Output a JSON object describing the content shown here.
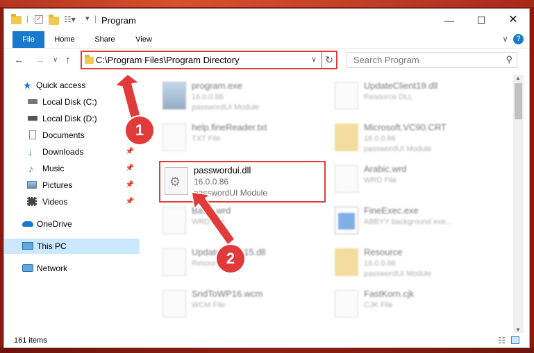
{
  "window": {
    "title": "Program"
  },
  "ribbon": {
    "tabs": [
      "File",
      "Home",
      "Share",
      "View"
    ],
    "help_label": "?",
    "expand_label": "∨"
  },
  "address": {
    "path": "C:\\Program Files\\Program Directory",
    "dropdown_label": "∨",
    "refresh_label": "↻"
  },
  "search": {
    "placeholder": "Search Program",
    "icon": "search-icon"
  },
  "nav": {
    "back": "←",
    "forward": "→",
    "recent": "∨",
    "up": "↑"
  },
  "sidebar": {
    "items": [
      {
        "label": "Quick access"
      },
      {
        "label": "Local Disk (C:)"
      },
      {
        "label": "Local Disk (D:)"
      },
      {
        "label": "Documents"
      },
      {
        "label": "Downloads"
      },
      {
        "label": "Music"
      },
      {
        "label": "Pictures"
      },
      {
        "label": "Videos"
      },
      {
        "label": "OneDrive"
      },
      {
        "label": "This PC"
      },
      {
        "label": "Network"
      }
    ]
  },
  "files": [
    {
      "name": "program.exe",
      "line2": "16.0.0.86",
      "line3": "passwordUI Module"
    },
    {
      "name": "UpdateClient19.dll",
      "line2": "Resource DLL",
      "line3": ""
    },
    {
      "name": "help.fineReader.txt",
      "line2": "TXT File",
      "line3": ""
    },
    {
      "name": "Microsoft.VC90.CRT",
      "line2": "16.0.0.86",
      "line3": "passwordUI Module"
    },
    {
      "name": "passwordui.dll",
      "line2": "16.0.0.86",
      "line3": "passwordUI Module"
    },
    {
      "name": "Arabic.wrd",
      "line2": "WRD File",
      "line3": ""
    },
    {
      "name": "Basic.wrd",
      "line2": "WRD File",
      "line3": ""
    },
    {
      "name": "FineExec.exe",
      "line2": "ABBYY background exe...",
      "line3": ""
    },
    {
      "name": "UpdateClient15.dll",
      "line2": "Resource DLL",
      "line3": ""
    },
    {
      "name": "Resource",
      "line2": "16.0.0.86",
      "line3": "passwordUI Module"
    },
    {
      "name": "SndToWP16.wcm",
      "line2": "WCM File",
      "line3": ""
    },
    {
      "name": "FastKorn.cjk",
      "line2": "CJK File",
      "line3": ""
    }
  ],
  "status": {
    "count": "161 items"
  },
  "callouts": [
    "1",
    "2"
  ],
  "colors": {
    "accent": "#1979ca",
    "highlight": "#e03a3a"
  }
}
